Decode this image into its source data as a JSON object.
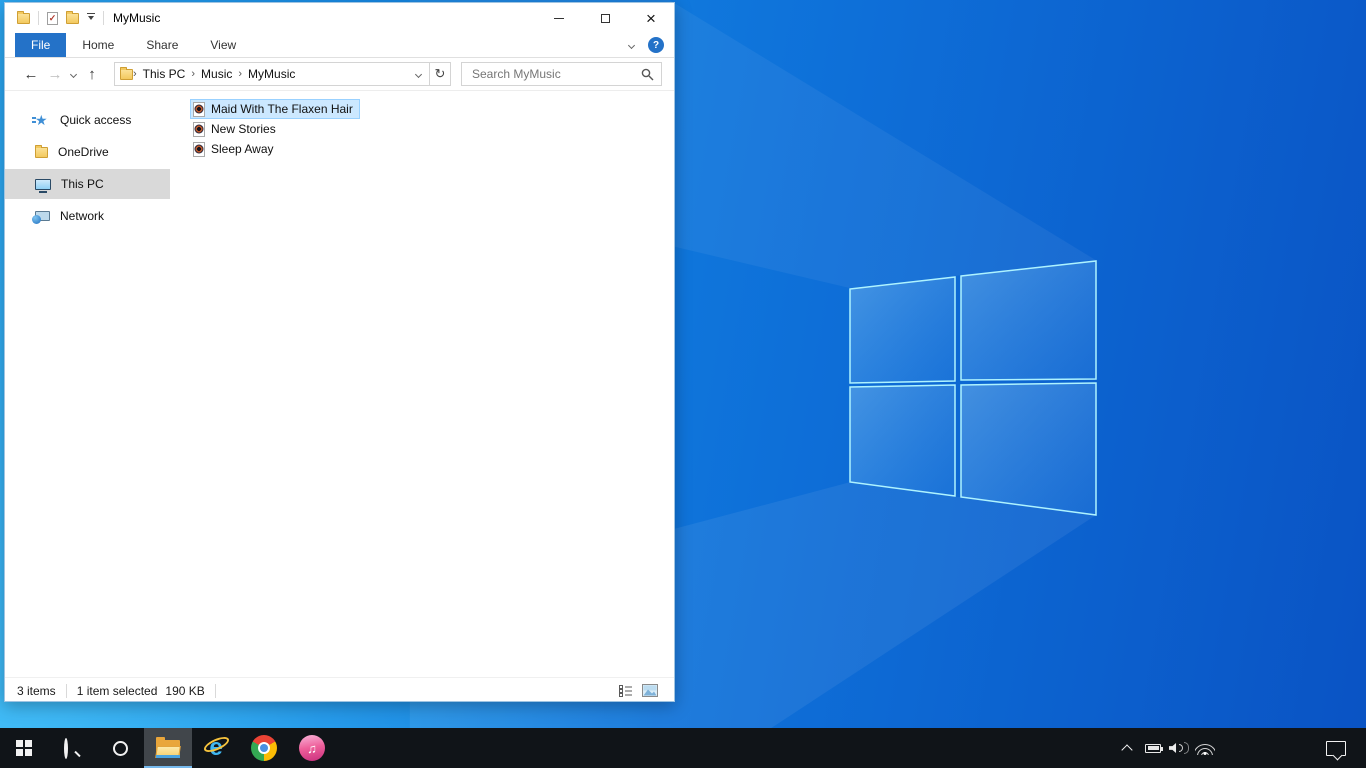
{
  "colors": {
    "accent": "#2472c8",
    "selection_bg": "#cce8ff",
    "selection_border": "#99d1ff",
    "sidebar_selected": "#d9d9d9",
    "taskbar_bg": "#101418",
    "taskbar_active_underline": "#76b9ed",
    "wp_light": "#2ba6f0",
    "wp_mid": "#0e6fd8",
    "wp_deep": "#0a53c4",
    "logo_edge": "#aef3ff"
  },
  "glyphs": {
    "back": "←",
    "forward": "→",
    "up": "↑",
    "refresh": "↻",
    "breadcrumb_sep": "›",
    "close": "×",
    "help": "?",
    "check": "✓",
    "star": "★",
    "note": "♫",
    "ie_e": "e"
  },
  "explorer": {
    "title": "MyMusic",
    "tabs": [
      {
        "label": "File",
        "active": true
      },
      {
        "label": "Home",
        "active": false
      },
      {
        "label": "Share",
        "active": false
      },
      {
        "label": "View",
        "active": false
      }
    ],
    "breadcrumb": [
      "This PC",
      "Music",
      "MyMusic"
    ],
    "search_placeholder": "Search MyMusic",
    "sidebar": [
      {
        "label": "Quick access",
        "icon": "quick-access-star-icon",
        "selected": false
      },
      {
        "label": "OneDrive",
        "icon": "folder-icon",
        "selected": false
      },
      {
        "label": "This PC",
        "icon": "monitor-icon",
        "selected": true
      },
      {
        "label": "Network",
        "icon": "network-icon",
        "selected": false
      }
    ],
    "files": [
      {
        "name": "Maid With The Flaxen Hair",
        "icon": "music-file-icon",
        "selected": true
      },
      {
        "name": "New Stories",
        "icon": "music-file-icon",
        "selected": false
      },
      {
        "name": "Sleep Away",
        "icon": "music-file-icon",
        "selected": false
      }
    ],
    "status": {
      "item_count": "3 items",
      "selection": "1 item selected",
      "selection_size": "190 KB"
    }
  },
  "taskbar": {
    "apps": [
      "start",
      "search",
      "cortana",
      "file-explorer",
      "internet-explorer",
      "chrome",
      "itunes"
    ],
    "active_app": "file-explorer",
    "tray": [
      "hidden-icons",
      "battery",
      "volume",
      "wifi"
    ],
    "action_center": "action-center"
  }
}
